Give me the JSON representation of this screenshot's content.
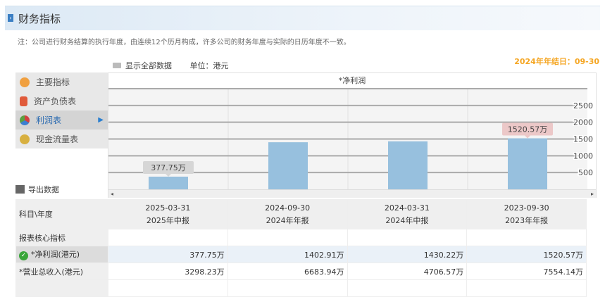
{
  "header": {
    "title": "财务指标"
  },
  "note": "注：公司进行财务结算的执行年度，由连续12个历月构成，许多公司的财务年度与实际的日历年度不一致。",
  "fiscal_year_end": "2024年年结日：09-30",
  "toolbar": {
    "show_all": "显示全部数据",
    "unit": "单位：港元"
  },
  "sidebar": {
    "items": [
      {
        "label": "主要指标",
        "color": "#f0a040"
      },
      {
        "label": "资产负债表",
        "color": "#e05a3a"
      },
      {
        "label": "利润表",
        "color": "#5aa040"
      },
      {
        "label": "现金流量表",
        "color": "#d8b040"
      }
    ],
    "active": 2
  },
  "export_label": "导出数据",
  "chart_data": {
    "type": "bar",
    "title": "*净利润",
    "categories": [
      "2025-03-31",
      "2024-09-30",
      "2024-03-31",
      "2023-09-30"
    ],
    "values": [
      377.75,
      1402.91,
      1430.22,
      1520.57
    ],
    "unit": "万",
    "yticks": [
      500,
      1000,
      1500,
      2000,
      2500
    ],
    "ylim": [
      0,
      3000
    ],
    "labels": [
      "377.75万",
      "1520.57万"
    ],
    "bar_color": "#97c0de"
  },
  "table": {
    "corner": "科目\\年度",
    "columns": [
      {
        "date": "2025-03-31",
        "type": "2025年中报"
      },
      {
        "date": "2024-09-30",
        "type": "2024年年报"
      },
      {
        "date": "2024-03-31",
        "type": "2024年中报"
      },
      {
        "date": "2023-09-30",
        "type": "2023年年报"
      }
    ],
    "section": "报表核心指标",
    "rows": [
      {
        "label": "*净利润(港元)",
        "values": [
          "377.75万",
          "1402.91万",
          "1430.22万",
          "1520.57万"
        ]
      },
      {
        "label": "*营业总收入(港元)",
        "values": [
          "3298.23万",
          "6683.94万",
          "4706.57万",
          "7554.14万"
        ]
      }
    ]
  }
}
